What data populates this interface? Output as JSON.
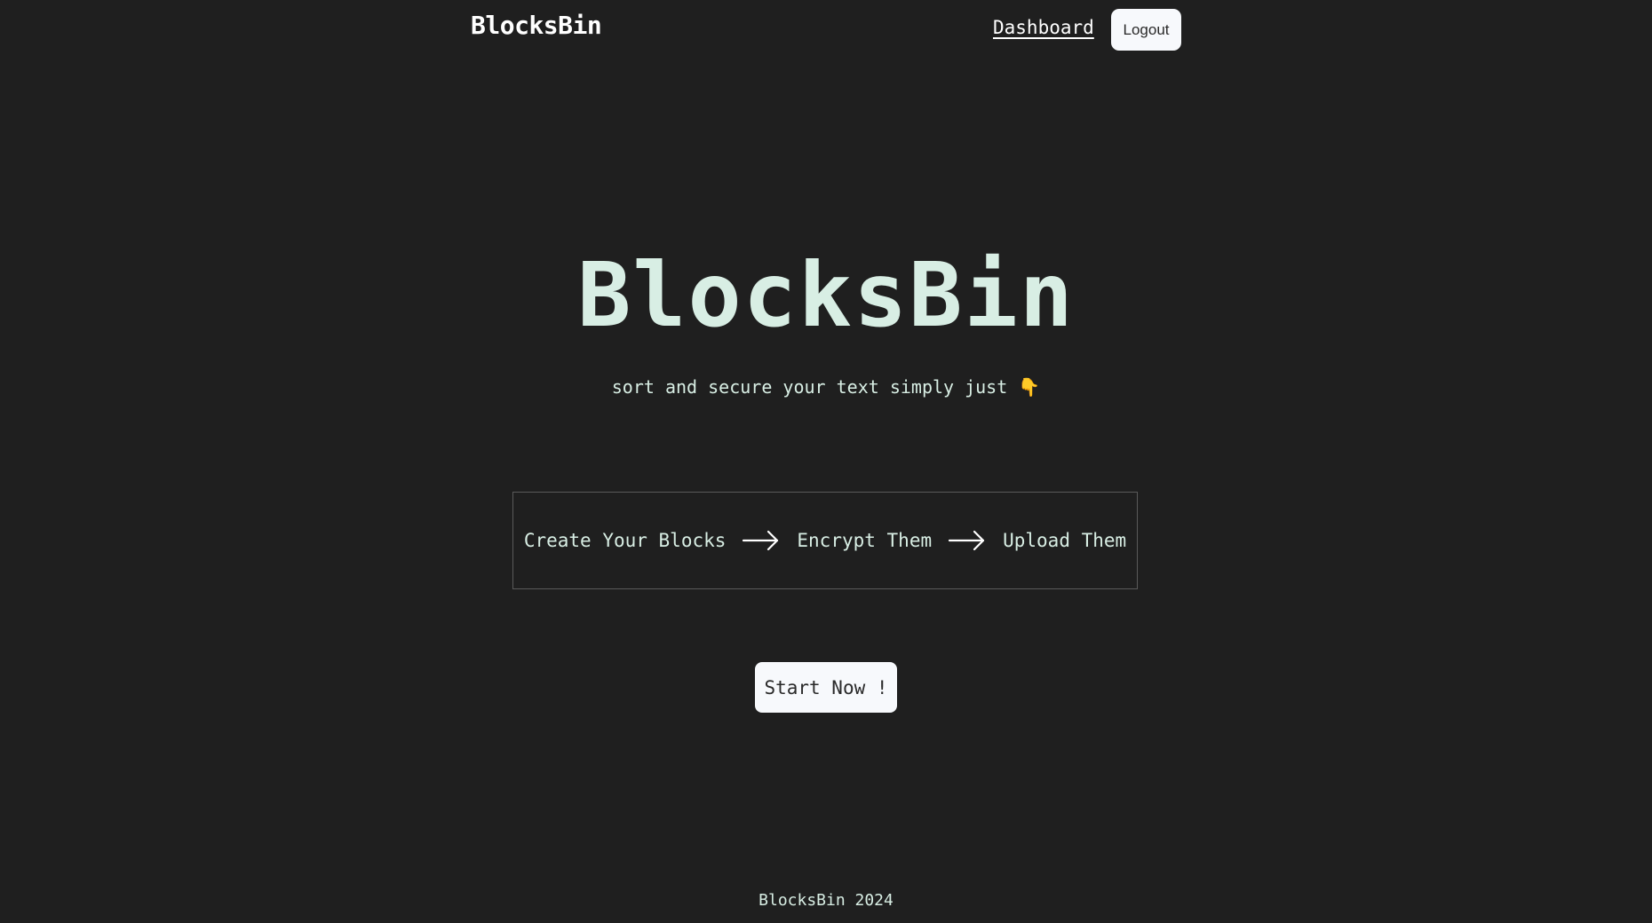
{
  "header": {
    "brand": "BlocksBin",
    "nav_dashboard": "Dashboard",
    "logout_label": "Logout"
  },
  "hero": {
    "title": "BlocksBin",
    "subtitle": "sort and secure your text simply just",
    "subtitle_emoji": "👇"
  },
  "steps": [
    "Create Your Blocks",
    "Encrypt Them",
    "Upload Them"
  ],
  "cta": {
    "label": "Start Now !"
  },
  "footer": {
    "text": "BlocksBin 2024"
  },
  "icons": {
    "step_separator": "arrow-right-icon"
  },
  "colors": {
    "background": "#1f1f1f",
    "accent_text": "#d8eee4",
    "button_bg": "#f7f9fc"
  }
}
